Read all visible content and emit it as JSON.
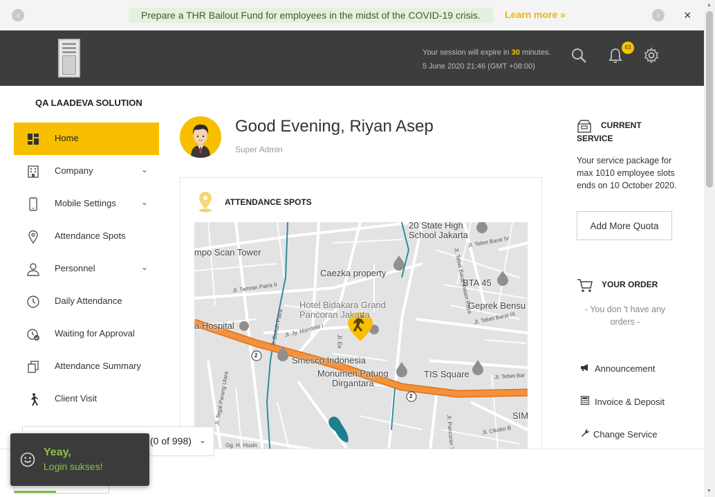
{
  "announcement": {
    "message": "Prepare a THR Bailout Fund for employees in the midst of the COVID-19 crisis.",
    "learn_more": "Learn more »",
    "prev_icon": "‹",
    "next_icon": "›",
    "close_icon": "×"
  },
  "header": {
    "session_prefix": "Your session will expire in",
    "session_minutes": "30",
    "session_suffix": "minutes.",
    "datetime": "5 June 2020 21:46 (GMT +08:00)",
    "notification_count": "63"
  },
  "sidebar": {
    "company": "QA LAADEVA SOLUTION",
    "items": [
      {
        "label": "Home",
        "icon": "dashboard-icon",
        "active": true,
        "has_submenu": false
      },
      {
        "label": "Company",
        "icon": "building-icon",
        "active": false,
        "has_submenu": true
      },
      {
        "label": "Mobile Settings",
        "icon": "mobile-icon",
        "active": false,
        "has_submenu": true
      },
      {
        "label": "Attendance Spots",
        "icon": "location-pin-icon",
        "active": false,
        "has_submenu": false
      },
      {
        "label": "Personnel",
        "icon": "person-icon",
        "active": false,
        "has_submenu": true
      },
      {
        "label": "Daily Attendance",
        "icon": "clock-icon",
        "active": false,
        "has_submenu": false
      },
      {
        "label": "Waiting for Approval",
        "icon": "approval-clock-icon",
        "active": false,
        "has_submenu": false
      },
      {
        "label": "Attendance Summary",
        "icon": "copy-icon",
        "active": false,
        "has_submenu": false
      },
      {
        "label": "Client Visit",
        "icon": "walking-person-icon",
        "active": false,
        "has_submenu": false
      }
    ],
    "chevron": "⌄"
  },
  "user": {
    "greeting": "Good Evening, Riyan Asep",
    "role": "Super Admin"
  },
  "attendance_card": {
    "title": "ATTENDANCE SPOTS",
    "map_labels": {
      "scan_tower": "mpo Scan Tower",
      "caezka": "Caezka property",
      "school": "20 State High\nSchool Jakarta",
      "bta": "BTA 45",
      "hotel": "Hotel Bidakara Grand\nPancoran Jakarta",
      "geprek": "Geprek Bensu",
      "hospital": "a Hospital",
      "smesco": "Smesco Indonesia",
      "monumen": "Monumen Patung\nDirgantara",
      "tis": "TIS Square",
      "sim": "SIM"
    },
    "street_labels": {
      "tamran": "Jl. Tamran Patra II",
      "dukuh": "Jl. Dukuh Patra",
      "mandala": "Jl. Jy. Mandala I",
      "tebet_barat_iv": "Jl. Tebet Barat IV",
      "tebet_barat_ix": "Jl. Tebet Barat IX",
      "tebet_raya": "Jl. Tebet Barat Dalam Raya",
      "tebet_timur": "Jl. Tebet Bar",
      "parang": "Jl. Tegal Parang Utara",
      "pancoran": "Jl. Pancoran Ti",
      "cikoko": "Jl. Cikoko B",
      "husin": "Gg. H. Husin",
      "ee": "Jl. Ee"
    },
    "route_badge": "2"
  },
  "service": {
    "title": "CURRENT SERVICE",
    "description": "Your service package for max 1010 employee slots ends on 10 October 2020.",
    "add_quota": "Add More Quota"
  },
  "order": {
    "title": "YOUR ORDER",
    "empty": "- You don 't have any orders -"
  },
  "side_links": [
    {
      "label": "Announcement",
      "icon": "megaphone-icon",
      "glyph": "📢"
    },
    {
      "label": "Invoice & Deposit",
      "icon": "calculator-icon",
      "glyph": "▦"
    },
    {
      "label": "Change Service",
      "icon": "wrench-icon",
      "glyph": "🔧"
    }
  ],
  "pager": {
    "count": "(0 of 998)",
    "chevron": "⌄"
  },
  "toast": {
    "title": "Yeay,",
    "message": "Login sukses!"
  },
  "colors": {
    "accent": "#f7bf00",
    "header_bg": "#3d3d3d",
    "toast_text": "#8bc34a",
    "map_road": "#f08a2c"
  }
}
